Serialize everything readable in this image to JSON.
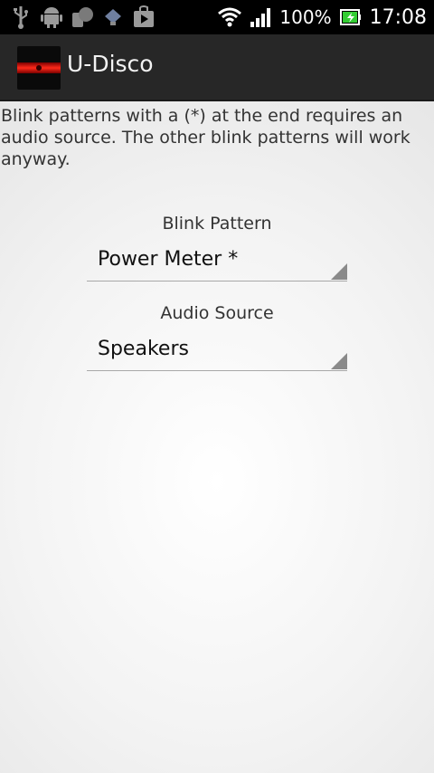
{
  "status_bar": {
    "left_icons": [
      "usb-icon",
      "android-debug-icon",
      "notification-icon",
      "storage-icon",
      "play-store-icon"
    ],
    "battery_percent": "100%",
    "time": "17:08"
  },
  "action_bar": {
    "title": "U-Disco"
  },
  "main": {
    "info_text": "Blink patterns with a (*) at the end requires an audio source. The other blink patterns will work anyway.",
    "blink_pattern": {
      "label": "Blink Pattern",
      "selected": "Power Meter *"
    },
    "audio_source": {
      "label": "Audio Source",
      "selected": "Speakers"
    }
  }
}
